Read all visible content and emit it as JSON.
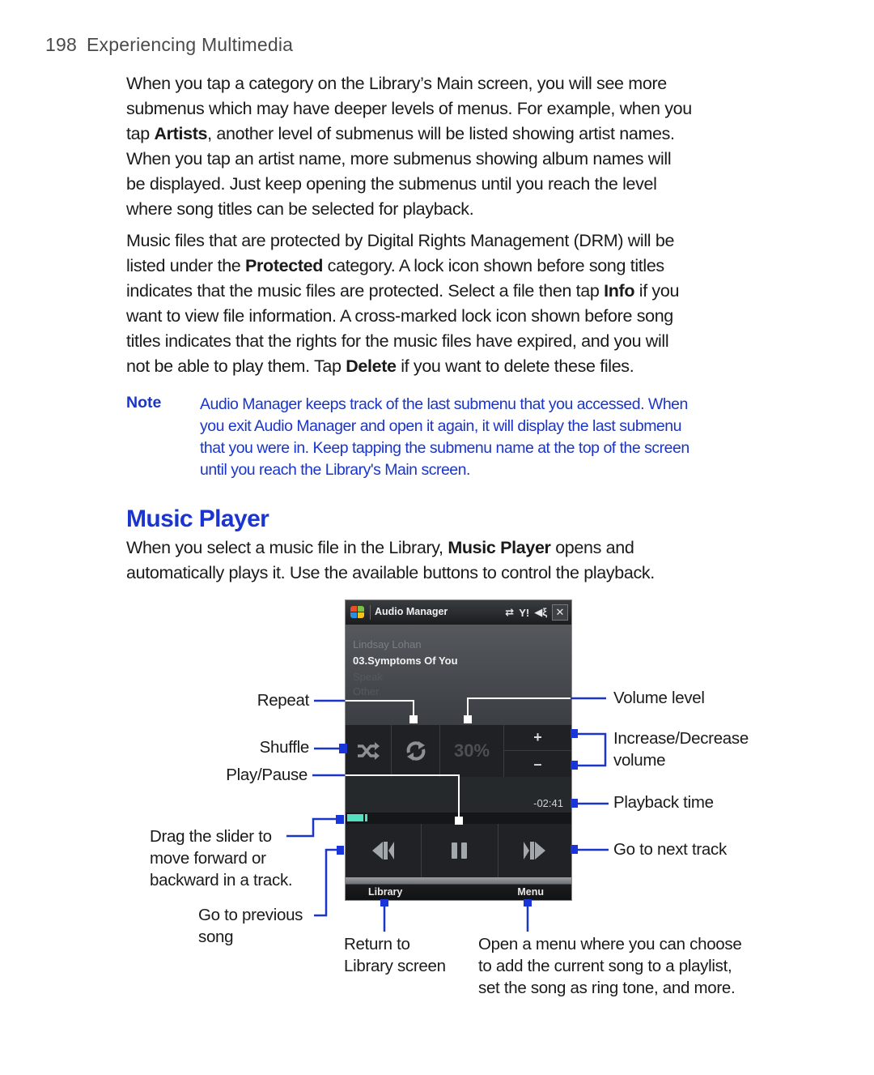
{
  "header": {
    "page_number": "198",
    "chapter": "Experiencing Multimedia"
  },
  "intro": {
    "paragraph1": [
      [
        "When you tap a category on the Library’s Main screen, you will see more"
      ],
      [
        "submenus which may have deeper levels of menus. For example, when you"
      ],
      [
        "tap ",
        {
          "b": "Artists"
        },
        ", another level of submenus will be listed showing artist names."
      ],
      [
        "When you tap an artist name, more submenus showing album names will"
      ],
      [
        "be displayed. Just keep opening the submenus until you reach the level"
      ],
      [
        "where song titles can be selected for playback."
      ]
    ],
    "paragraph2": [
      [
        "Music files that are protected by Digital Rights Management (DRM) will be"
      ],
      [
        "listed under the ",
        {
          "b": "Protected"
        },
        " category. A lock icon shown before song titles"
      ],
      [
        "indicates that the music files are protected. Select a file then tap ",
        {
          "b": "Info"
        },
        " if you"
      ],
      [
        "want to view file information. A cross-marked lock icon shown before song"
      ],
      [
        "titles indicates that the rights for the music files have expired, and you will"
      ],
      [
        "not be able to play them. Tap ",
        {
          "b": "Delete"
        },
        " if you want to delete these files."
      ]
    ]
  },
  "note": {
    "label": "Note",
    "lines": [
      "Audio Manager keeps track of the last submenu that you accessed. When",
      "you exit Audio Manager and open it again, it will display the last submenu",
      "that you were in. Keep tapping the submenu name at the top of the screen",
      "until you reach the Library's Main screen."
    ]
  },
  "section": {
    "title": "Music Player",
    "paragraph": [
      [
        "When you select a music file in the Library, ",
        {
          "b": "Music Player"
        },
        " opens and"
      ],
      [
        "automatically plays it. Use the available buttons to control the playback."
      ]
    ]
  },
  "phone": {
    "app_title": "Audio Manager",
    "tray_icons": [
      "sync-icon",
      "signal-icon",
      "speaker-muted-icon"
    ],
    "close_label": "✕",
    "artist": "Lindsay Lohan",
    "song": "03.Symptoms Of You",
    "album": "Speak",
    "genre": "Other",
    "volume": "30%",
    "plus": "+",
    "minus": "–",
    "time": "-02:41",
    "progress_fraction": 0.09,
    "softkey_left": "Library",
    "softkey_right": "Menu",
    "colors": {
      "seek_fill": "#54e0c0",
      "callout_blue": "#1a35c8"
    }
  },
  "callouts": {
    "repeat": "Repeat",
    "shuffle": "Shuffle",
    "play_pause": "Play/Pause",
    "slider": [
      "Drag the slider to",
      "move forward or",
      "backward in a track."
    ],
    "previous": [
      "Go to previous",
      "song"
    ],
    "volume_level": "Volume level",
    "inc_dec": [
      "Increase/Decrease",
      "volume"
    ],
    "playback_time": "Playback time",
    "next_track": "Go to next track",
    "library": [
      "Return to",
      "Library screen"
    ],
    "menu": [
      "Open a menu where you can choose",
      "to add the current song to a playlist,",
      "set the song as ring tone, and more."
    ]
  }
}
